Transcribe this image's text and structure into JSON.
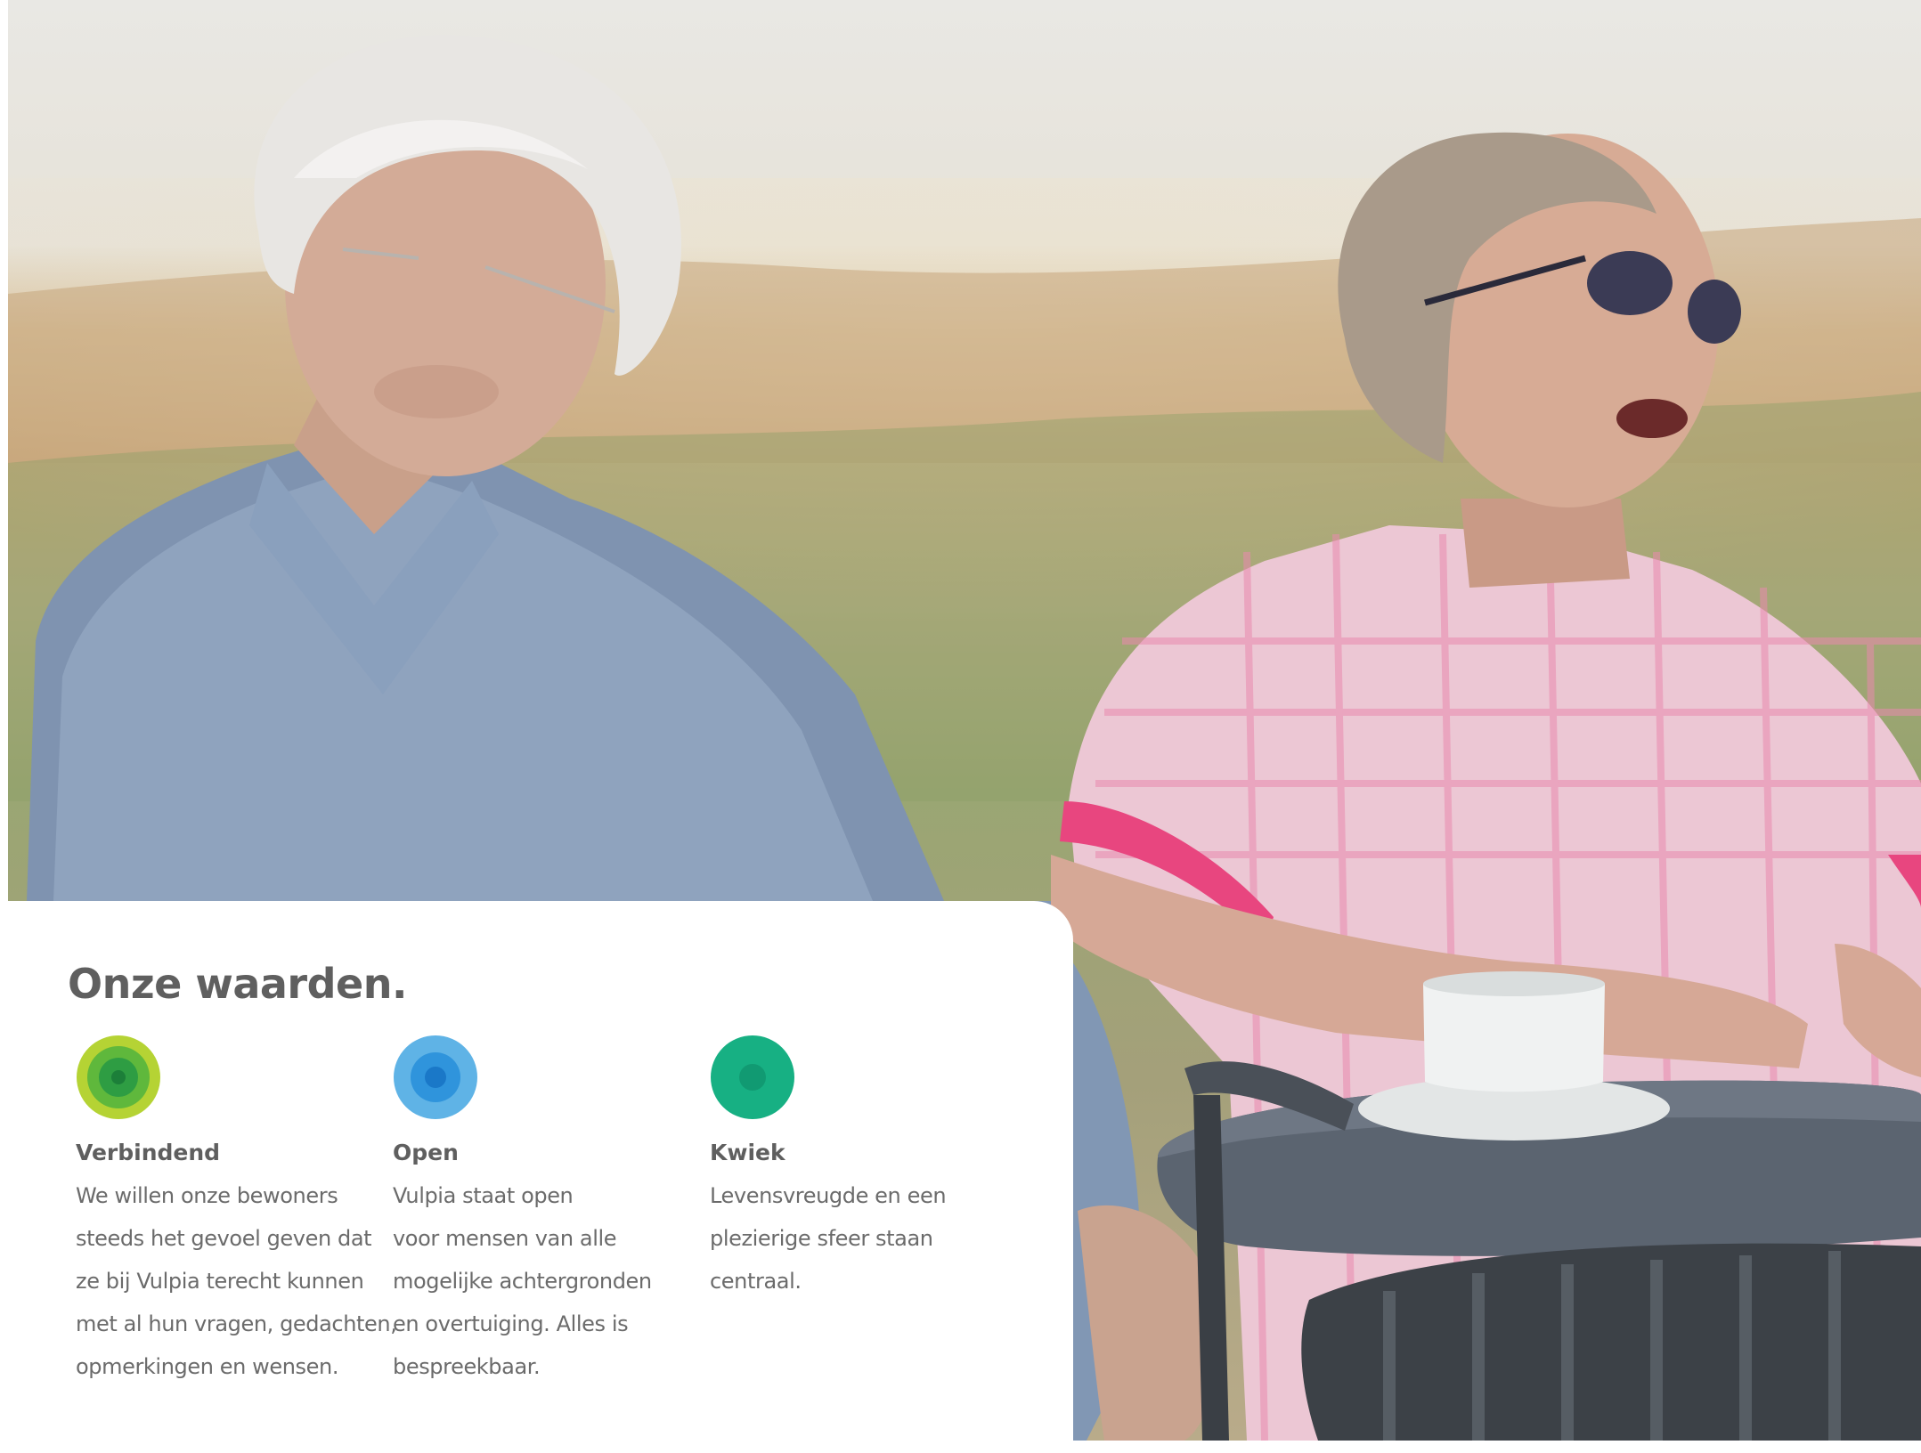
{
  "section": {
    "heading": "Onze waarden."
  },
  "values": [
    {
      "name": "Verbindend",
      "icon": "concentric-circles-green-icon",
      "colors": [
        "#b5d334",
        "#5fb83c",
        "#2e9d43",
        "#1c7f39"
      ],
      "lines": [
        "We willen onze bewoners",
        "steeds het gevoel geven dat",
        "ze bij Vulpia terecht kunnen",
        "met al hun vragen, gedachten,",
        "opmerkingen en wensen."
      ]
    },
    {
      "name": "Open",
      "icon": "concentric-circles-blue-icon",
      "colors": [
        "#5fb3e6",
        "#2f94dc",
        "#1a78c8"
      ],
      "lines": [
        "Vulpia staat open",
        "voor mensen van alle",
        "mogelijke achtergronden",
        "en overtuiging. Alles is",
        "bespreekbaar."
      ]
    },
    {
      "name": "Kwiek",
      "icon": "concentric-circles-teal-icon",
      "colors": [
        "#17b083",
        "#119a72"
      ],
      "lines": [
        "Levensvreugde en een",
        "plezierige sfeer staan",
        "centraal."
      ]
    }
  ]
}
